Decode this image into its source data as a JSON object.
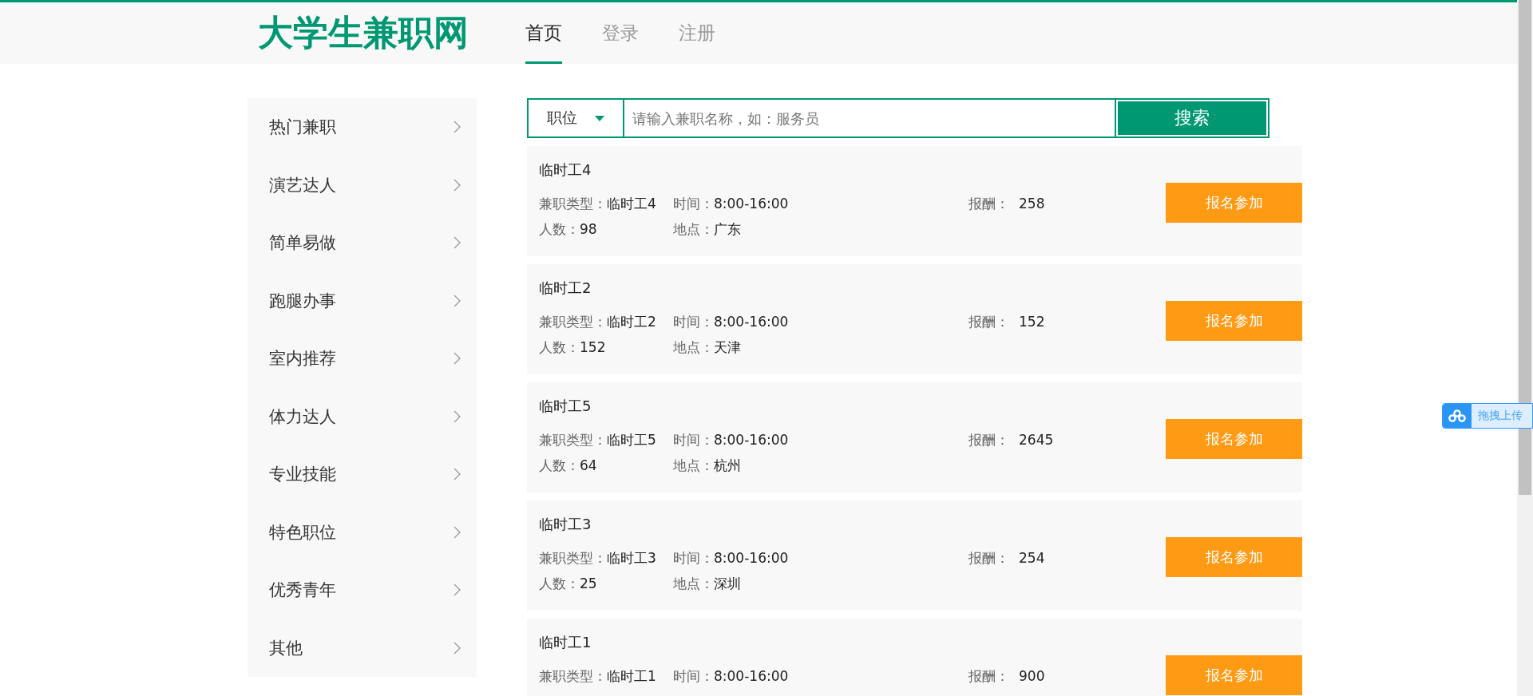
{
  "header": {
    "logo": "大学生兼职网",
    "nav": [
      {
        "label": "首页",
        "selected": true
      },
      {
        "label": "登录",
        "selected": false
      },
      {
        "label": "注册",
        "selected": false
      }
    ]
  },
  "sidebar": {
    "items": [
      {
        "label": "热门兼职"
      },
      {
        "label": "演艺达人"
      },
      {
        "label": "简单易做"
      },
      {
        "label": "跑腿办事"
      },
      {
        "label": "室内推荐"
      },
      {
        "label": "体力达人"
      },
      {
        "label": "专业技能"
      },
      {
        "label": "特色职位"
      },
      {
        "label": "优秀青年"
      },
      {
        "label": "其他"
      }
    ]
  },
  "search": {
    "category": "职位",
    "placeholder": "请输入兼职名称，如：服务员",
    "button": "搜索"
  },
  "jobs": [
    {
      "title": "临时工4",
      "rows": [
        [
          {
            "label": "兼职类型：",
            "value": "临时工4"
          },
          {
            "label": "时间：",
            "value": "8:00-16:00"
          },
          {
            "label": "报酬：",
            "value": "258"
          }
        ],
        [
          {
            "label": "人数：",
            "value": "98"
          },
          {
            "label": "地点：",
            "value": "广东"
          }
        ]
      ],
      "button": "报名参加"
    },
    {
      "title": "临时工2",
      "rows": [
        [
          {
            "label": "兼职类型：",
            "value": "临时工2"
          },
          {
            "label": "时间：",
            "value": "8:00-16:00"
          },
          {
            "label": "报酬：",
            "value": "152"
          }
        ],
        [
          {
            "label": "人数：",
            "value": "152"
          },
          {
            "label": "地点：",
            "value": "天津"
          }
        ]
      ],
      "button": "报名参加"
    },
    {
      "title": "临时工5",
      "rows": [
        [
          {
            "label": "兼职类型：",
            "value": "临时工5"
          },
          {
            "label": "时间：",
            "value": "8:00-16:00"
          },
          {
            "label": "报酬：",
            "value": "2645"
          }
        ],
        [
          {
            "label": "人数：",
            "value": "64"
          },
          {
            "label": "地点：",
            "value": "杭州"
          }
        ]
      ],
      "button": "报名参加"
    },
    {
      "title": "临时工3",
      "rows": [
        [
          {
            "label": "兼职类型：",
            "value": "临时工3"
          },
          {
            "label": "时间：",
            "value": "8:00-16:00"
          },
          {
            "label": "报酬：",
            "value": "254"
          }
        ],
        [
          {
            "label": "人数：",
            "value": "25"
          },
          {
            "label": "地点：",
            "value": "深圳"
          }
        ]
      ],
      "button": "报名参加"
    },
    {
      "title": "临时工1",
      "rows": [
        [
          {
            "label": "兼职类型：",
            "value": "临时工1"
          },
          {
            "label": "时间：",
            "value": "8:00-16:00"
          },
          {
            "label": "报酬：",
            "value": "900"
          }
        ]
      ],
      "button": "报名参加"
    }
  ],
  "upload_widget": {
    "label": "拖拽上传"
  }
}
